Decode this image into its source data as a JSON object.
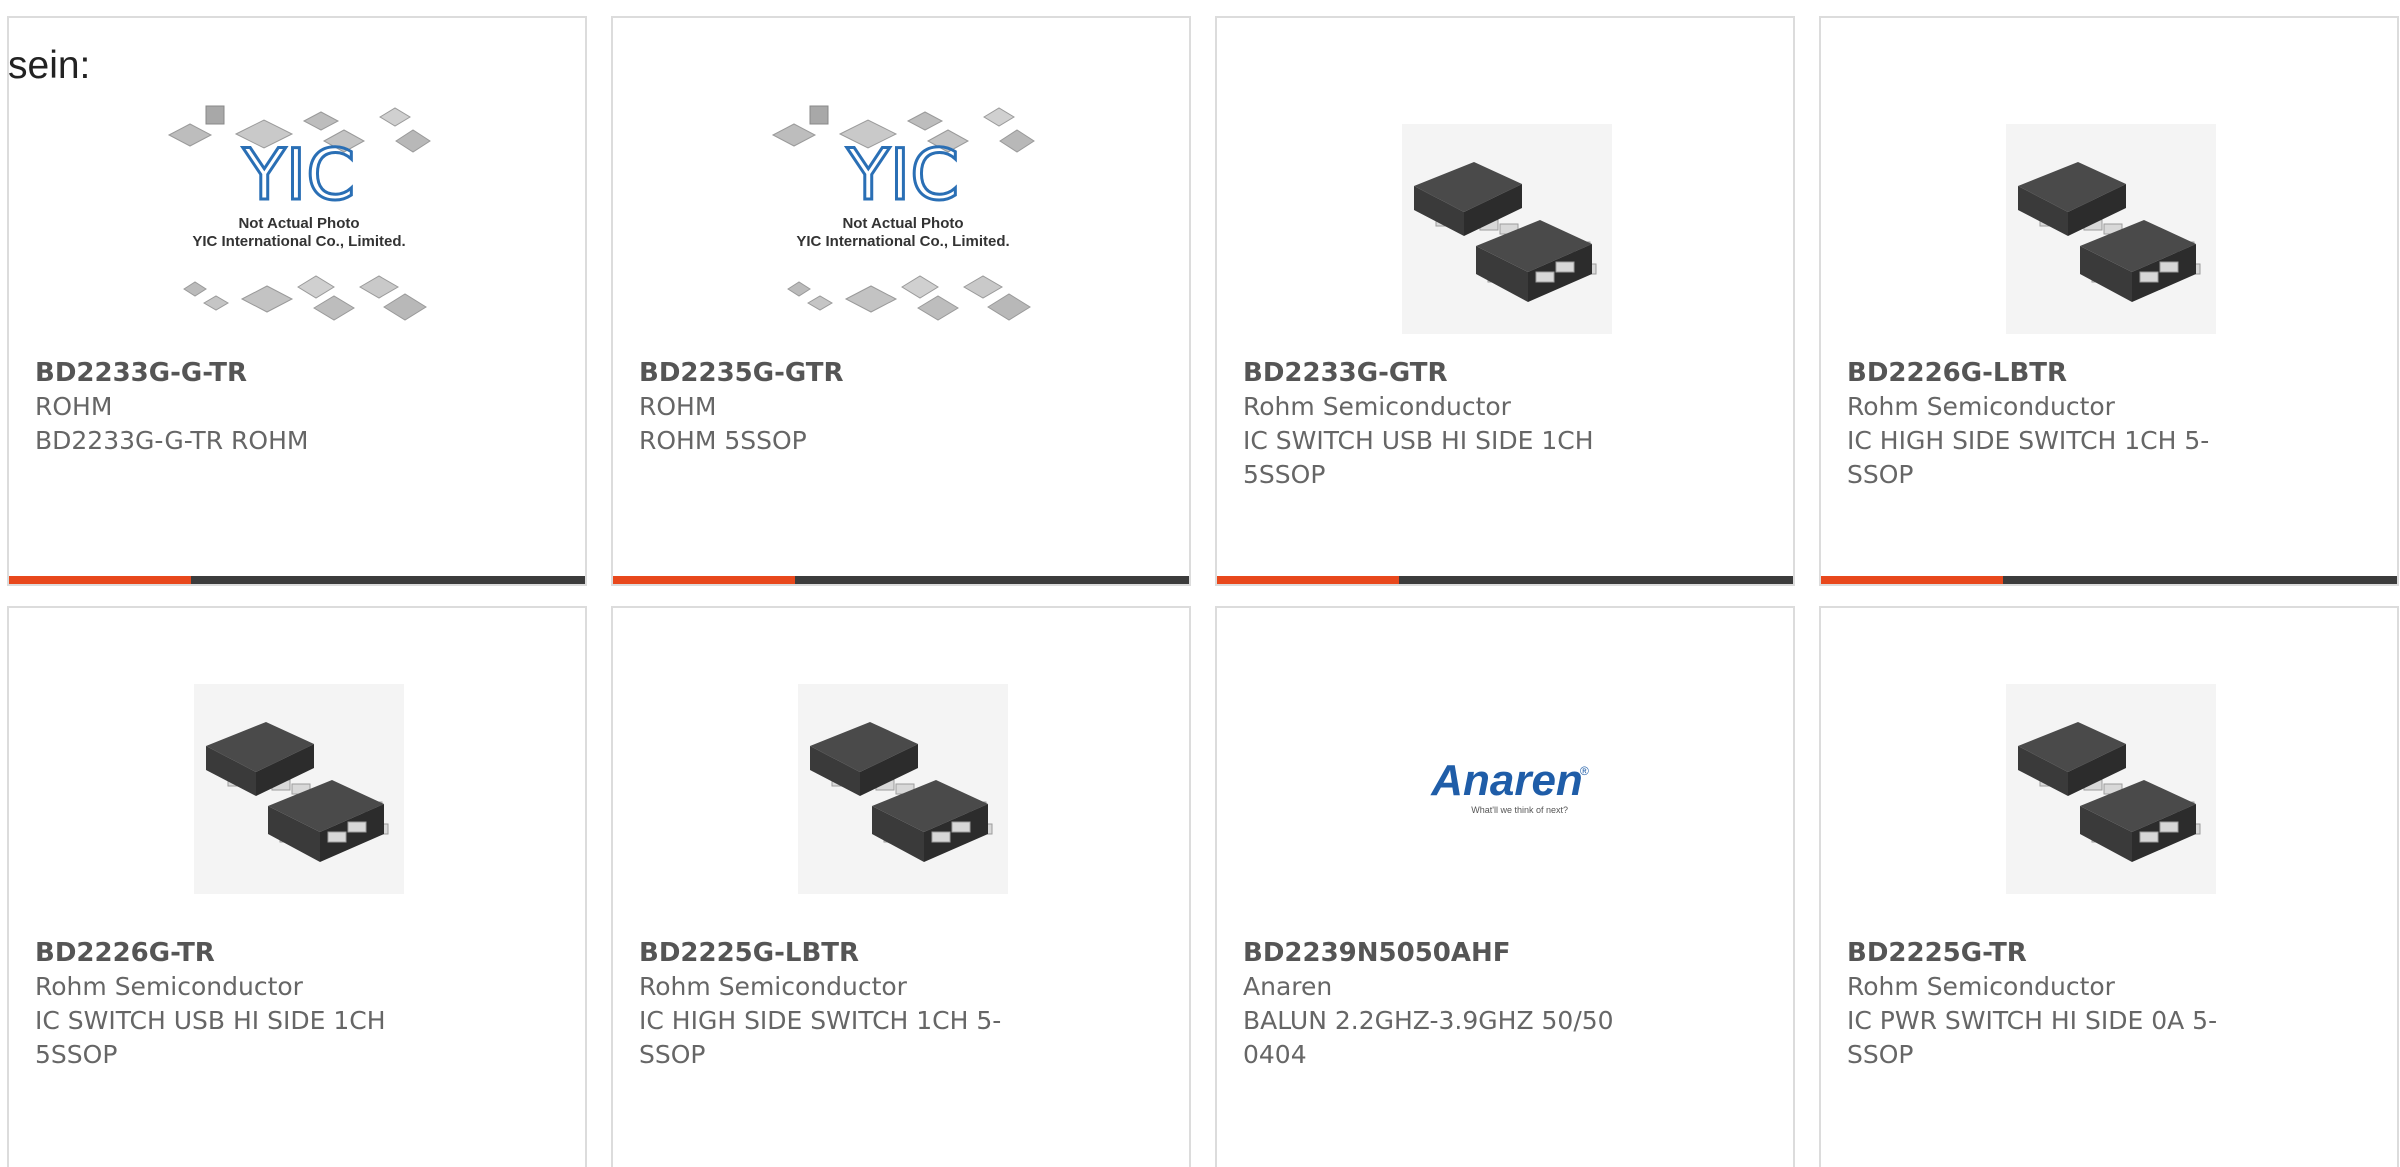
{
  "lead_text": "sein:",
  "colors": {
    "accent": "#e8481c",
    "bar_dark": "#3c3c3c",
    "card_border": "#dcdcdc",
    "chip_body": "#3a3a3a",
    "yic_blue": "#2a6fb5",
    "anaren_blue": "#1f5da8"
  },
  "placeholder_image": {
    "logo_text": "YIC",
    "line1": "Not Actual Photo",
    "line2": "YIC International Co., Limited."
  },
  "anaren_logo": {
    "name": "Anaren",
    "mark": "®",
    "tagline": "What'll we think of next?"
  },
  "products": [
    {
      "part_number": "BD2233G-G-TR",
      "brand": "ROHM",
      "description": "BD2233G-G-TR ROHM",
      "image": "yic-placeholder",
      "has_bar": true
    },
    {
      "part_number": "BD2235G-GTR",
      "brand": "ROHM",
      "description": "ROHM 5SSOP",
      "image": "yic-placeholder",
      "has_bar": true
    },
    {
      "part_number": "BD2233G-GTR",
      "brand": "Rohm Semiconductor",
      "description": "IC SWITCH USB HI SIDE 1CH\n5SSOP",
      "image": "ssop-chip",
      "has_bar": true
    },
    {
      "part_number": "BD2226G-LBTR",
      "brand": "Rohm Semiconductor",
      "description": "IC HIGH SIDE SWITCH 1CH 5-\nSSOP",
      "image": "ssop-chip",
      "has_bar": true
    },
    {
      "part_number": "BD2226G-TR",
      "brand": "Rohm Semiconductor",
      "description": "IC SWITCH USB HI SIDE 1CH\n5SSOP",
      "image": "ssop-chip",
      "has_bar": false
    },
    {
      "part_number": "BD2225G-LBTR",
      "brand": "Rohm Semiconductor",
      "description": "IC HIGH SIDE SWITCH 1CH 5-\nSSOP",
      "image": "ssop-chip",
      "has_bar": false
    },
    {
      "part_number": "BD2239N5050AHF",
      "brand": "Anaren",
      "description": "BALUN 2.2GHZ-3.9GHZ 50/50\n0404",
      "image": "anaren-logo",
      "has_bar": false
    },
    {
      "part_number": "BD2225G-TR",
      "brand": "Rohm Semiconductor",
      "description": "IC PWR SWITCH HI SIDE 0A 5-\nSSOP",
      "image": "ssop-chip",
      "has_bar": false
    }
  ]
}
